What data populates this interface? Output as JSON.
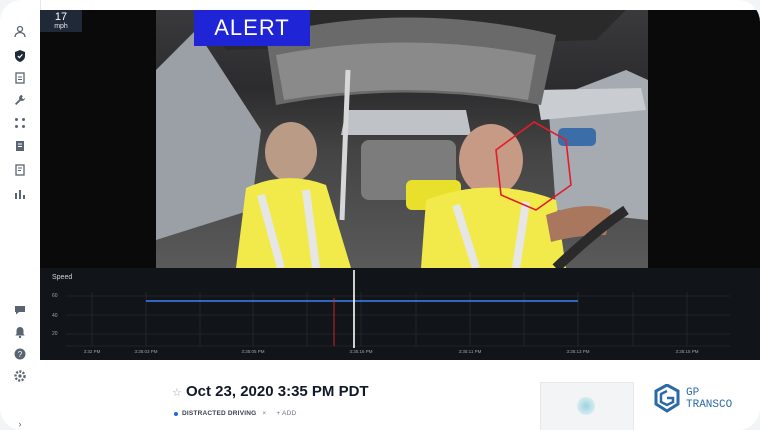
{
  "speed_badge": {
    "value": "17",
    "unit": "mph"
  },
  "alert": {
    "label": "ALERT"
  },
  "graph": {
    "title": "Speed",
    "y_ticks": [
      "60",
      "40",
      "20"
    ],
    "x_ticks": [
      "3:32 PM",
      "3:35:03 PM",
      "3:35:05 PM",
      "3:35:16 PM",
      "3:35:11 PM",
      "3:35:13 PM",
      "3:35:15 PM"
    ]
  },
  "event": {
    "time": "Oct 23, 2020 3:35 PM PDT",
    "tag": "DISTRACTED DRIVING",
    "tag_remove": "×",
    "add_label": "+ ADD"
  },
  "brand": {
    "line1": "GP",
    "line2": "TRANSCO"
  },
  "colors": {
    "alert_bg": "#1f24d6",
    "series": "#3b82f6",
    "marker": "#dc2626",
    "playhead": "#ffffff",
    "brand": "#2b6aa8"
  },
  "sidebar_icons": [
    "users-icon",
    "shield-icon",
    "document-icon",
    "wrench-icon",
    "route-icon",
    "file-icon",
    "report-icon",
    "bar-chart-icon",
    "chat-icon",
    "bell-icon",
    "help-icon",
    "settings-icon",
    "chevron-right-icon"
  ]
}
